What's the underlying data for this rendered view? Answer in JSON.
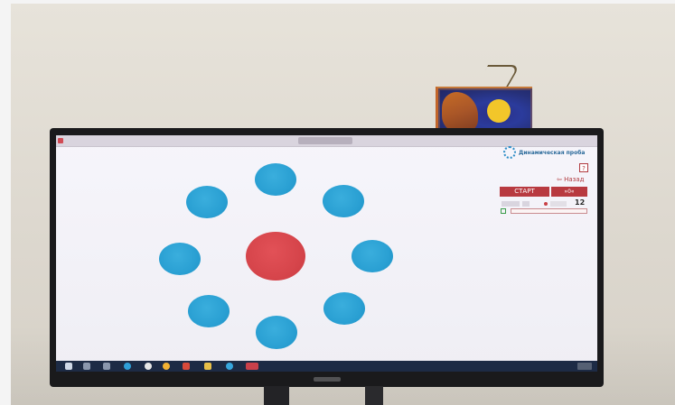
{
  "app": {
    "brand": "Динамическая проба",
    "help_label": "?",
    "back_label": "⇦ Назад",
    "start_label": "СТАРТ",
    "arrow_label": "»0«",
    "counter_value": "12"
  },
  "colors": {
    "target_blue": "#2aa0d3",
    "center_red": "#d6454b",
    "accent_red": "#b83a40",
    "taskbar": "#1d2b45"
  },
  "icons": {
    "brand": "dotted-circle-icon",
    "timer": "hourglass-icon",
    "pointer": "mouse-cursor-icon"
  },
  "taskbar_icons": [
    "windows-start-icon",
    "search-icon",
    "task-view-icon",
    "edge-browser-icon",
    "yandex-browser-icon",
    "chrome-icon",
    "app-red-icon",
    "file-explorer-icon",
    "telegram-icon",
    "app-active-icon"
  ]
}
